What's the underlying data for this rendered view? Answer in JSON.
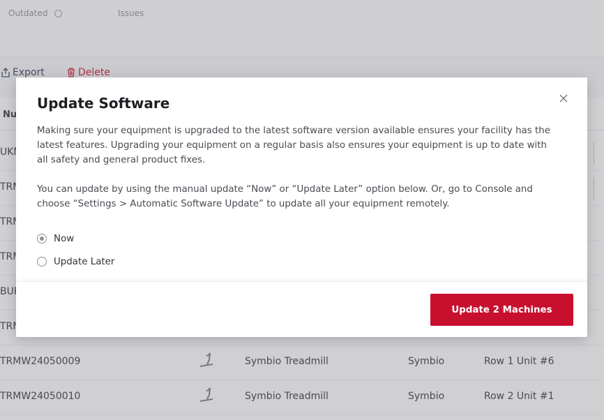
{
  "stats": {
    "outdated_label": "Outdated",
    "issues_label": "Issues"
  },
  "toolbar": {
    "export_label": "Export",
    "delete_label": "Delete"
  },
  "table": {
    "first_column_header": "Nu",
    "rows": [
      {
        "id": "UKM"
      },
      {
        "id": "TRM"
      },
      {
        "id": "TRM"
      },
      {
        "id": "TRM"
      },
      {
        "id": "BUP"
      },
      {
        "id": "TRM"
      },
      {
        "id": "TRMW24050009",
        "name": "Symbio Treadmill",
        "brand": "Symbio",
        "location": "Row 1 Unit #6"
      },
      {
        "id": "TRMW24050010",
        "name": "Symbio Treadmill",
        "brand": "Symbio",
        "location": "Row 2 Unit #1"
      }
    ]
  },
  "modal": {
    "title": "Update Software",
    "paragraph_1": "Making sure your equipment is upgraded to the latest software version available ensures your facility has the latest features. Upgrading your equipment on a regular basis also ensures your equipment is up to date with all safety and general product fixes.",
    "paragraph_2": "You can update by using the manual update “Now” or “Update Later” option below. Or, go to Console and choose “Settings > Automatic Software Update” to update all your equipment remotely.",
    "options": [
      {
        "label": "Now",
        "selected": true
      },
      {
        "label": "Update Later",
        "selected": false
      }
    ],
    "primary_button_label": "Update 2 Machines",
    "close_icon": "close-icon"
  },
  "colors": {
    "brand_red": "#c8102e",
    "text_dark": "#1e1e24",
    "text_body": "#4a4a52"
  }
}
